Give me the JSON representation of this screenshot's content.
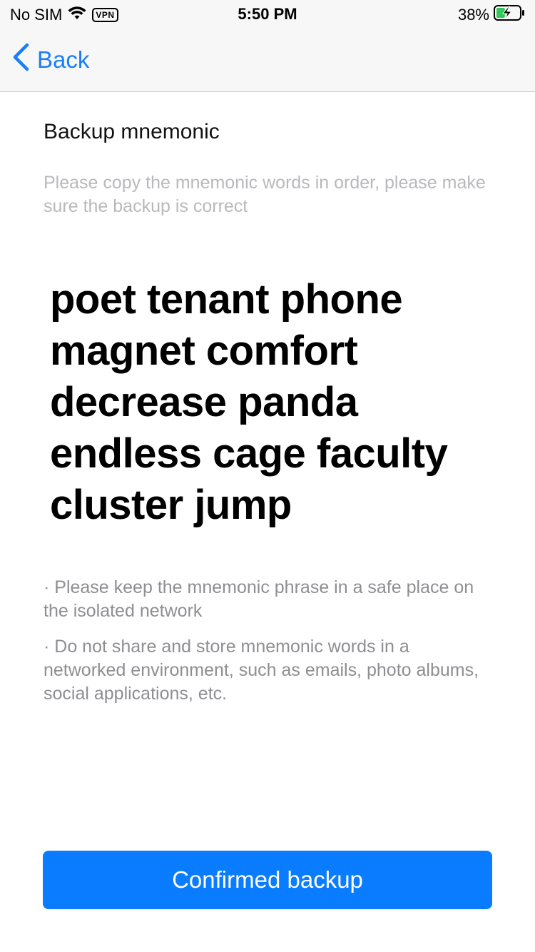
{
  "status_bar": {
    "carrier": "No SIM",
    "vpn": "VPN",
    "time": "5:50 PM",
    "battery": "38%",
    "battery_level": 0.38
  },
  "nav": {
    "back_label": "Back"
  },
  "content": {
    "title": "Backup mnemonic",
    "subtitle": "Please copy the mnemonic words in order, please make sure the backup is correct",
    "mnemonic": "poet tenant phone magnet comfort decrease panda endless cage faculty cluster jump",
    "notes": [
      "· Please keep the mnemonic phrase in a safe place on the isolated network",
      "· Do not share and store mnemonic words in a networked environment, such as emails, photo albums, social applications, etc."
    ]
  },
  "actions": {
    "confirm_label": "Confirmed backup"
  },
  "colors": {
    "accent": "#0a7cff",
    "back_link": "#1a7ff7",
    "battery_green": "#34c759"
  }
}
